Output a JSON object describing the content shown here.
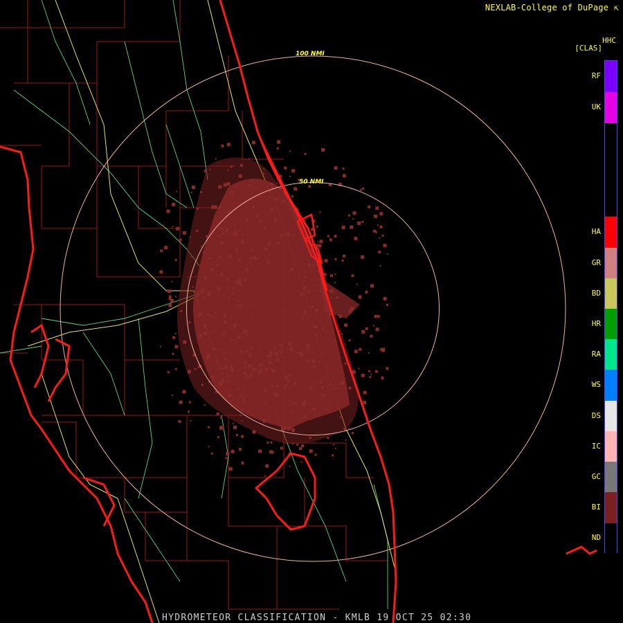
{
  "header": {
    "credit": "NEXLAB-College of DuPage",
    "credit_icon": "arrow-icon"
  },
  "footer": {
    "title": "HYDROMETEOR CLASSIFICATION - KMLB 19 OCT 25 02:30"
  },
  "legend": {
    "product": "HHC",
    "subtitle": "[CLAS]",
    "classes": [
      {
        "code": "RF",
        "color": "#7b00ff"
      },
      {
        "code": "UK",
        "color": "#e600e6"
      },
      {
        "code": "HA",
        "color": "#ff0000"
      },
      {
        "code": "GR",
        "color": "#d08080"
      },
      {
        "code": "BD",
        "color": "#c8c85a"
      },
      {
        "code": "HR",
        "color": "#00a000"
      },
      {
        "code": "RA",
        "color": "#00e68c"
      },
      {
        "code": "WS",
        "color": "#0080ff"
      },
      {
        "code": "DS",
        "color": "#e6e6e6"
      },
      {
        "code": "IC",
        "color": "#ffb4b4"
      },
      {
        "code": "GC",
        "color": "#787878"
      },
      {
        "code": "BI",
        "color": "#7a2020"
      },
      {
        "code": "ND",
        "color": "#000000"
      }
    ]
  },
  "range_rings": [
    {
      "label": "100 NMI",
      "radius_nmi": 100
    },
    {
      "label": "50 NMI",
      "radius_nmi": 50
    }
  ],
  "colors": {
    "coastline": "#ff1a1a",
    "county_lines": "#a01414",
    "highways": "#ffff66",
    "roads": "#66ff99",
    "range_ring": "#f0b4a0",
    "biological_echo": "#8b2a2a"
  }
}
